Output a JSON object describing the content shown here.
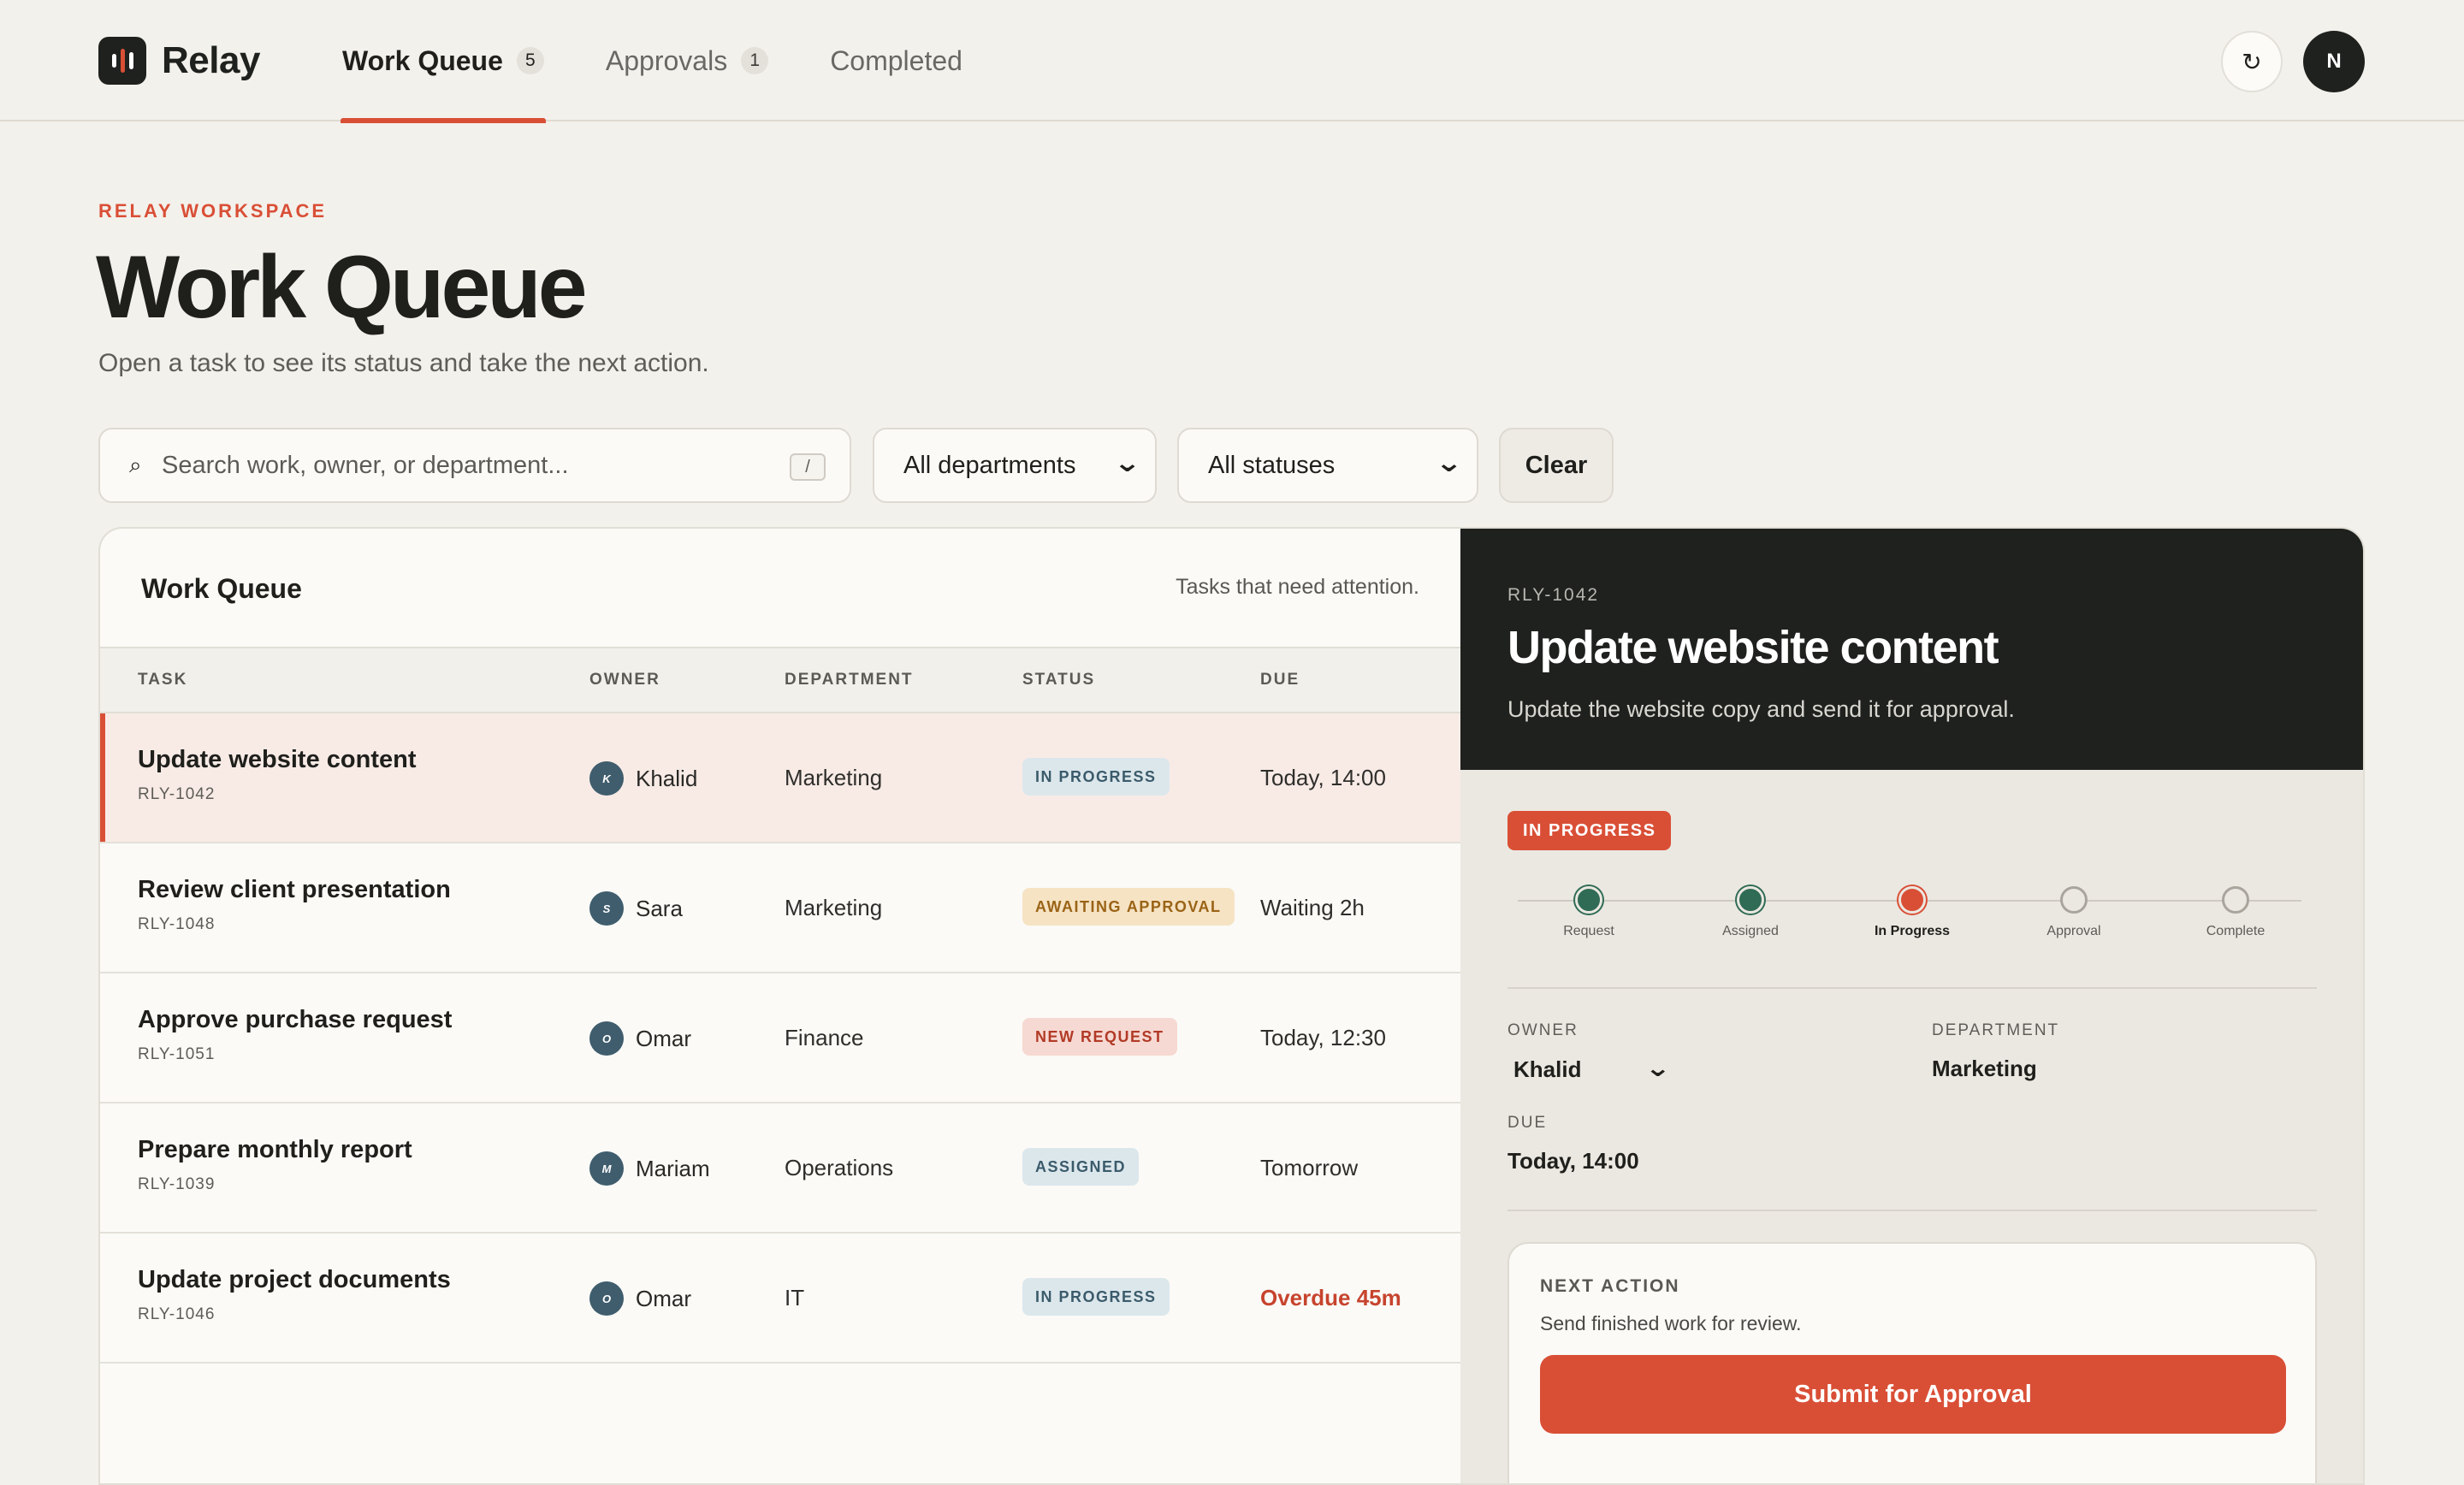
{
  "app": {
    "name": "Relay"
  },
  "nav": {
    "tabs": [
      {
        "label": "Work Queue",
        "count": "5"
      },
      {
        "label": "Approvals",
        "count": "1"
      },
      {
        "label": "Completed"
      }
    ],
    "refresh_icon": "↻",
    "user_initial": "N"
  },
  "header": {
    "eyebrow": "RELAY WORKSPACE",
    "title": "Work Queue",
    "subtitle": "Open a task to see its status and take the next action."
  },
  "filters": {
    "search_placeholder": "Search work, owner, or department...",
    "search_shortcut": "/",
    "department": "All departments",
    "status": "All statuses",
    "clear_label": "Clear"
  },
  "queue": {
    "title": "Work Queue",
    "note": "Tasks that need attention.",
    "columns": [
      "TASK",
      "OWNER",
      "DEPARTMENT",
      "STATUS",
      "DUE"
    ],
    "rows": [
      {
        "title": "Update website content",
        "id": "RLY-1042",
        "owner_initial": "K",
        "owner": "Khalid",
        "department": "Marketing",
        "status": "IN PROGRESS",
        "due": "Today, 14:00"
      },
      {
        "title": "Review client presentation",
        "id": "RLY-1048",
        "owner_initial": "S",
        "owner": "Sara",
        "department": "Marketing",
        "status": "AWAITING APPROVAL",
        "due": "Waiting 2h"
      },
      {
        "title": "Approve purchase request",
        "id": "RLY-1051",
        "owner_initial": "O",
        "owner": "Omar",
        "department": "Finance",
        "status": "NEW REQUEST",
        "due": "Today, 12:30"
      },
      {
        "title": "Prepare monthly report",
        "id": "RLY-1039",
        "owner_initial": "M",
        "owner": "Mariam",
        "department": "Operations",
        "status": "ASSIGNED",
        "due": "Tomorrow"
      },
      {
        "title": "Update project documents",
        "id": "RLY-1046",
        "owner_initial": "O",
        "owner": "Omar",
        "department": "IT",
        "status": "IN PROGRESS",
        "due": "Overdue 45m"
      }
    ]
  },
  "detail": {
    "id": "RLY-1042",
    "title": "Update website content",
    "description": "Update the website copy and send it for approval.",
    "status": "IN PROGRESS",
    "steps": [
      "Request",
      "Assigned",
      "In Progress",
      "Approval",
      "Complete"
    ],
    "owner_label": "OWNER",
    "owner": "Khalid",
    "department_label": "DEPARTMENT",
    "department": "Marketing",
    "due_label": "DUE",
    "due": "Today, 14:00",
    "next_action_label": "NEXT ACTION",
    "next_action_text": "Send finished work for review.",
    "submit_label": "Submit for Approval"
  },
  "colors": {
    "accent": "#d94f36",
    "dark": "#1f211e",
    "step_done": "#2f6b55",
    "background": "#f3f1ec"
  }
}
